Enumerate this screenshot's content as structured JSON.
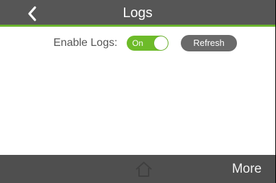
{
  "header": {
    "title": "Logs",
    "back_icon": "chevron-left-icon"
  },
  "logs_settings": {
    "enable_label": "Enable Logs:",
    "toggle_state": "On",
    "toggle_color": "#6dbb29",
    "refresh_label": "Refresh"
  },
  "footer": {
    "home_icon": "home-icon",
    "more_label": "More"
  },
  "colors": {
    "header_bg": "#565656",
    "accent": "#6ab42d",
    "footer_bg": "#4f4f4f"
  }
}
